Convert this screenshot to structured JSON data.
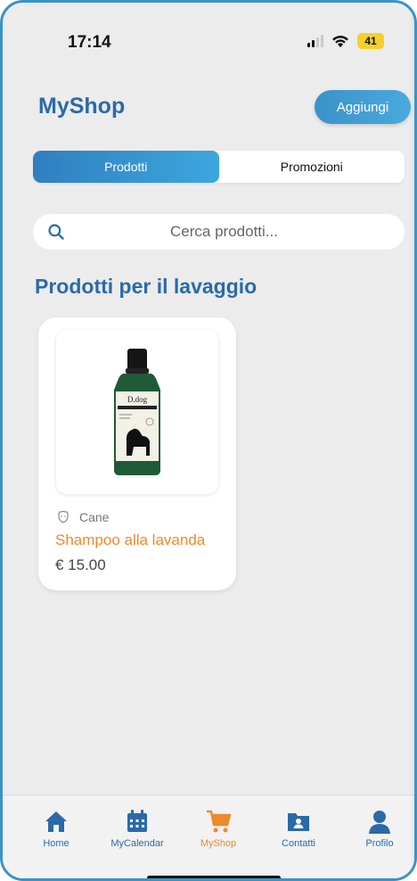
{
  "status_bar": {
    "time": "17:14",
    "battery": "41"
  },
  "header": {
    "title": "MyShop",
    "add_label": "Aggiungi"
  },
  "tabs": [
    {
      "label": "Prodotti",
      "active": true
    },
    {
      "label": "Promozioni",
      "active": false
    }
  ],
  "search": {
    "placeholder": "Cerca prodotti...",
    "icon": "search-icon"
  },
  "section": {
    "title": "Prodotti per il lavaggio"
  },
  "products": [
    {
      "category": "Cane",
      "name": "Shampoo alla lavanda",
      "price": "€ 15.00",
      "brand": "D.dog"
    }
  ],
  "nav": [
    {
      "label": "Home",
      "icon": "home-icon",
      "active": false
    },
    {
      "label": "MyCalendar",
      "icon": "calendar-icon",
      "active": false
    },
    {
      "label": "MyShop",
      "icon": "cart-icon",
      "active": true
    },
    {
      "label": "Contatti",
      "icon": "contacts-icon",
      "active": false
    },
    {
      "label": "Profilo",
      "icon": "profile-icon",
      "active": false
    }
  ],
  "colors": {
    "primary": "#2b6aa8",
    "accent": "#ec8a2c",
    "battery": "#f4d12a"
  }
}
